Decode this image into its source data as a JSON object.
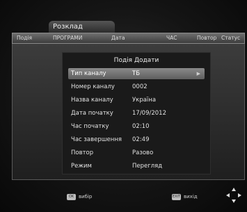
{
  "window": {
    "title": "Розклад"
  },
  "columns": [
    "Подія",
    "ПРОГРАМИ",
    "Дата",
    "ЧАС",
    "Повтор",
    "Статус"
  ],
  "dialog": {
    "title": "Подія Додати",
    "fields": [
      {
        "label": "Тип каналу",
        "value": "ТБ"
      },
      {
        "label": "Номер каналу",
        "value": "0002"
      },
      {
        "label": "Назва каналу",
        "value": "Україна"
      },
      {
        "label": "Дата початку",
        "value": "17/09/2012"
      },
      {
        "label": "Час початку",
        "value": "02:10"
      },
      {
        "label": "Час завершення",
        "value": "02:49"
      },
      {
        "label": "Повтор",
        "value": "Разово"
      },
      {
        "label": "Режим",
        "value": "Перегляд"
      }
    ]
  },
  "footer": {
    "select_key": "OK",
    "select_label": "вибір",
    "exit_key": "EXIT",
    "exit_label": "вихід"
  }
}
